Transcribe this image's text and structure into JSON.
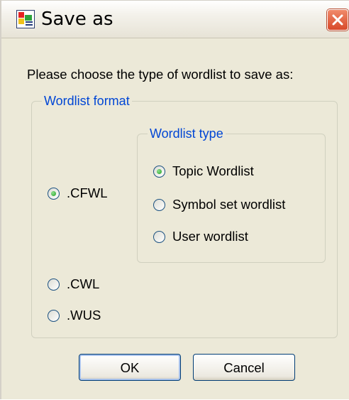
{
  "window": {
    "title": "Save as",
    "icon": "wordlist-app-icon",
    "close_icon": "close-icon",
    "close_color": "#d8492a"
  },
  "prompt": "Please choose the type of wordlist to save as:",
  "format_group": {
    "legend": "Wordlist format",
    "options": [
      ".CFWL",
      ".CWL",
      ".WUS"
    ],
    "selected": ".CFWL"
  },
  "type_group": {
    "legend": "Wordlist type",
    "options": [
      "Topic Wordlist",
      "Symbol set wordlist",
      "User wordlist"
    ],
    "selected": "Topic Wordlist"
  },
  "buttons": {
    "ok": "OK",
    "cancel": "Cancel"
  },
  "colors": {
    "legend_text": "#0046d5",
    "dialog_bg": "#ece9d8",
    "button_border": "#003c74",
    "radio_selected": "#21a121"
  }
}
